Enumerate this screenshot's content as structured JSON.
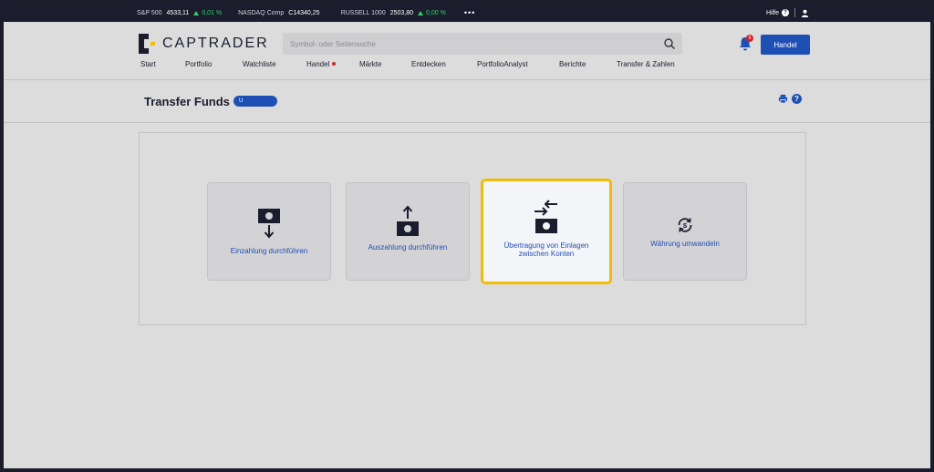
{
  "ticker": {
    "items": [
      {
        "name": "S&P 500",
        "value": "4533,11",
        "change": "0,01 %"
      },
      {
        "name": "NASDAQ Comp",
        "value": "C14340,25",
        "change": ""
      },
      {
        "name": "RUSSELL 1000",
        "value": "2503,80",
        "change": "0,00 %"
      }
    ],
    "more": "•••",
    "help_label": "Hilfe"
  },
  "header": {
    "logo_text": "CAPTRADER",
    "search_placeholder": "Symbol- oder Seitensuche",
    "notification_count": "5",
    "trade_button": "Handel"
  },
  "nav": {
    "items": [
      "Start",
      "Portfolio",
      "Watchliste",
      "Handel",
      "Märkte",
      "Entdecken",
      "PortfolioAnalyst",
      "Berichte",
      "Transfer & Zahlen"
    ]
  },
  "page": {
    "title": "Transfer Funds",
    "account_badge": "U"
  },
  "cards": [
    {
      "label": "Einzahlung durchführen",
      "icon": "deposit-icon",
      "active": false
    },
    {
      "label": "Auszahlung durchführen",
      "icon": "withdraw-icon",
      "active": false
    },
    {
      "label": "Übertragung von Einlagen zwischen Konten",
      "icon": "transfer-icon",
      "active": true
    },
    {
      "label": "Währung umwandeln",
      "icon": "currency-convert-icon",
      "active": false
    }
  ],
  "colors": {
    "accent": "#1e4fb5",
    "dark": "#1b1d2e",
    "highlight": "#f2bd00",
    "positive": "#2fcf6a",
    "alert": "#d2232a"
  }
}
